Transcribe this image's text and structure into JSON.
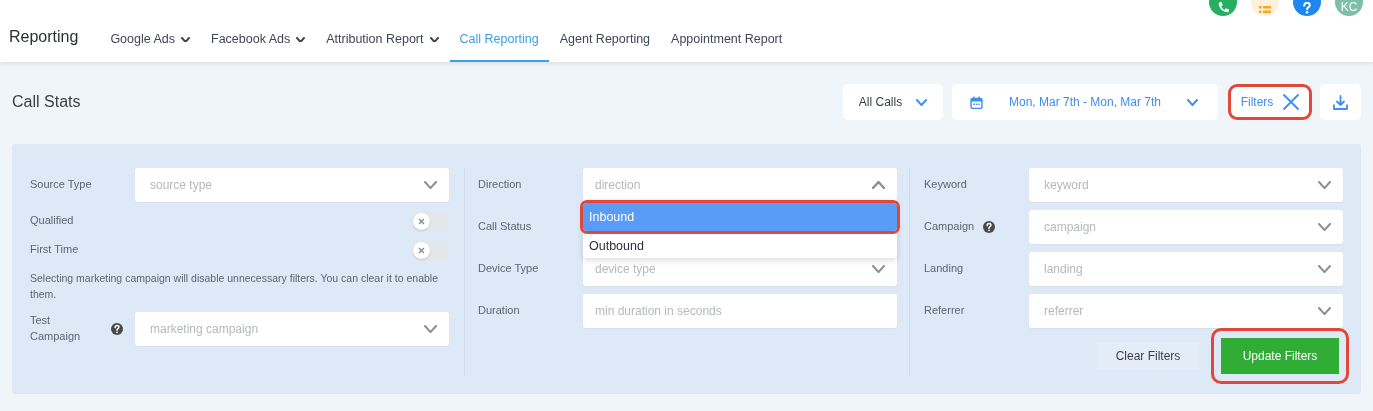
{
  "header_icons": [
    {
      "kind": "phone",
      "color": "#27ae60"
    },
    {
      "kind": "list",
      "color": "#fdf1da"
    },
    {
      "kind": "help",
      "color": "#1e88f0"
    },
    {
      "kind": "avatar",
      "label": "KC",
      "color": "#7dbfa8"
    }
  ],
  "nav": {
    "title": "Reporting",
    "tabs": [
      {
        "label": "Google Ads",
        "dropdown": true,
        "selected": false
      },
      {
        "label": "Facebook Ads",
        "dropdown": true,
        "selected": false
      },
      {
        "label": "Attribution Report",
        "dropdown": true,
        "selected": false
      },
      {
        "label": "Call Reporting",
        "dropdown": false,
        "selected": true
      },
      {
        "label": "Agent Reporting",
        "dropdown": false,
        "selected": false
      },
      {
        "label": "Appointment Report",
        "dropdown": false,
        "selected": false
      }
    ]
  },
  "toolbar": {
    "title": "Call Stats",
    "call_type": "All Calls",
    "date_range": "Mon, Mar 7th - Mon, Mar 7th",
    "filters_button": {
      "label": "Filters",
      "highlighted": true
    }
  },
  "filters": {
    "columns": [
      {
        "fields": [
          {
            "kind": "select",
            "label": "Source Type",
            "placeholder": "source type",
            "help": false,
            "expanded": false
          },
          {
            "kind": "toggle",
            "label": "Qualified",
            "on": false
          },
          {
            "kind": "toggle",
            "label": "First Time",
            "on": false
          },
          {
            "kind": "note",
            "text": "Selecting marketing campaign will disable unnecessary filters. You can clear it to enable them."
          },
          {
            "kind": "select",
            "label": "Test Campaign",
            "placeholder": "marketing campaign",
            "help": true,
            "expanded": false
          }
        ]
      },
      {
        "fields": [
          {
            "kind": "select",
            "label": "Direction",
            "placeholder": "direction",
            "help": false,
            "expanded": true
          },
          {
            "kind": "covered",
            "label": "Call Status",
            "help": false
          },
          {
            "kind": "select",
            "label": "Device Type",
            "placeholder": "device type",
            "help": false,
            "expanded": false
          },
          {
            "kind": "text",
            "label": "Duration",
            "placeholder": "min duration in seconds",
            "help": false
          }
        ]
      },
      {
        "fields": [
          {
            "kind": "select",
            "label": "Keyword",
            "placeholder": "keyword",
            "help": false,
            "expanded": false
          },
          {
            "kind": "select",
            "label": "Campaign",
            "placeholder": "campaign",
            "help": true,
            "expanded": false
          },
          {
            "kind": "select",
            "label": "Landing",
            "placeholder": "landing",
            "help": false,
            "expanded": false
          },
          {
            "kind": "select",
            "label": "Referrer",
            "placeholder": "referrer",
            "help": false,
            "expanded": false
          }
        ]
      }
    ],
    "dropdown": {
      "options": [
        {
          "label": "Inbound",
          "selected": true,
          "highlighted": true
        },
        {
          "label": "Outbound",
          "selected": false,
          "highlighted": false
        }
      ]
    },
    "buttons": [
      {
        "kind": "secondary",
        "label": "Clear Filters",
        "highlighted": false
      },
      {
        "kind": "primary",
        "label": "Update Filters",
        "highlighted": true
      }
    ]
  }
}
